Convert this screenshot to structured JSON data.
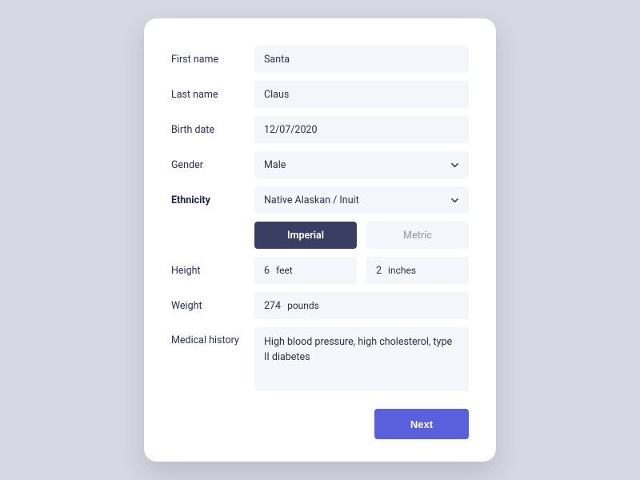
{
  "labels": {
    "first_name": "First name",
    "last_name": "Last name",
    "birth_date": "Birth date",
    "gender": "Gender",
    "ethnicity": "Ethnicity",
    "height": "Height",
    "weight": "Weight",
    "medical_history": "Medical history"
  },
  "values": {
    "first_name": "Santa",
    "last_name": "Claus",
    "birth_date": "12/07/2020",
    "gender": "Male",
    "ethnicity": "Native Alaskan / Inuit",
    "height_primary": "6",
    "height_primary_unit": "feet",
    "height_secondary": "2",
    "height_secondary_unit": "inches",
    "weight": "274",
    "weight_unit": "pounds",
    "medical_history": "High blood pressure, high cholesterol, type II diabetes"
  },
  "units_toggle": {
    "imperial": "Imperial",
    "metric": "Metric",
    "active": "imperial"
  },
  "buttons": {
    "next": "Next"
  }
}
